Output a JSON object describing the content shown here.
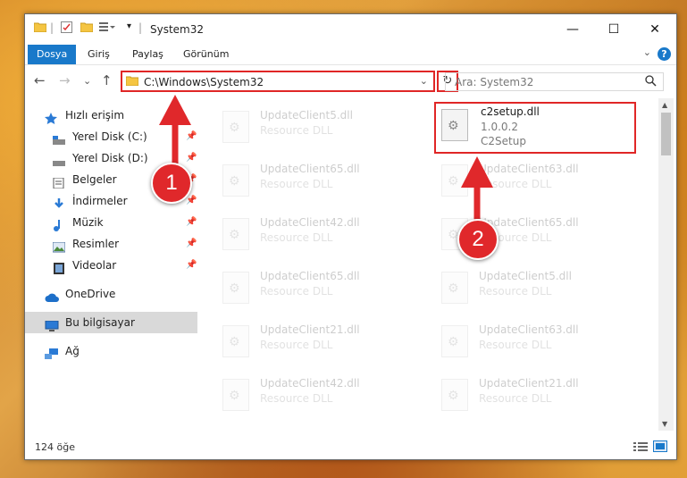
{
  "window": {
    "title": "System32",
    "controls": {
      "minimize": "—",
      "maximize": "☐",
      "close": "✕"
    }
  },
  "ribbon": {
    "tabs": [
      "Dosya",
      "Giriş",
      "Paylaş",
      "Görünüm"
    ],
    "help": "?"
  },
  "nav": {
    "back": "←",
    "forward": "→",
    "recent": "⌄",
    "up": "↑",
    "address": "C:\\Windows\\System32",
    "dropdown": "⌄",
    "refresh": "↻",
    "search_placeholder": "Ara: System32",
    "search_icon": "search-icon"
  },
  "sidebar": {
    "items": [
      {
        "label": "Hızlı erişim",
        "icon": "star-icon",
        "pinned": false
      },
      {
        "label": "Yerel Disk (C:)",
        "icon": "drive-icon",
        "pinned": true
      },
      {
        "label": "Yerel Disk (D:)",
        "icon": "drive-icon",
        "pinned": true
      },
      {
        "label": "Belgeler",
        "icon": "document-icon",
        "pinned": true
      },
      {
        "label": "İndirmeler",
        "icon": "download-icon",
        "pinned": true
      },
      {
        "label": "Müzik",
        "icon": "music-icon",
        "pinned": true
      },
      {
        "label": "Resimler",
        "icon": "pictures-icon",
        "pinned": true
      },
      {
        "label": "Videolar",
        "icon": "video-icon",
        "pinned": true
      },
      {
        "label": "OneDrive",
        "icon": "cloud-icon",
        "pinned": false
      },
      {
        "label": "Bu bilgisayar",
        "icon": "computer-icon",
        "pinned": false,
        "selected": true
      },
      {
        "label": "Ağ",
        "icon": "network-icon",
        "pinned": false
      }
    ],
    "pin_glyph": "📌"
  },
  "files": {
    "left": [
      {
        "name": "UpdateClient5.dll",
        "type": "Resource DLL"
      },
      {
        "name": "UpdateClient65.dll",
        "type": "Resource DLL"
      },
      {
        "name": "UpdateClient42.dll",
        "type": "Resource DLL"
      },
      {
        "name": "UpdateClient65.dll",
        "type": "Resource DLL"
      },
      {
        "name": "UpdateClient21.dll",
        "type": "Resource DLL"
      },
      {
        "name": "UpdateClient42.dll",
        "type": "Resource DLL"
      }
    ],
    "highlighted": {
      "name": "c2setup.dll",
      "version": "1.0.0.2",
      "description": "C2Setup"
    },
    "right": [
      {
        "name": "UpdateClient63.dll",
        "type": "Resource DLL"
      },
      {
        "name": "UpdateClient65.dll",
        "type": "Resource DLL"
      },
      {
        "name": "UpdateClient5.dll",
        "type": "Resource DLL"
      },
      {
        "name": "UpdateClient63.dll",
        "type": "Resource DLL"
      },
      {
        "name": "UpdateClient21.dll",
        "type": "Resource DLL"
      }
    ]
  },
  "status": {
    "item_count": "124 öğe"
  },
  "annotations": {
    "step1": "1",
    "step2": "2",
    "color": "#e0282b"
  }
}
